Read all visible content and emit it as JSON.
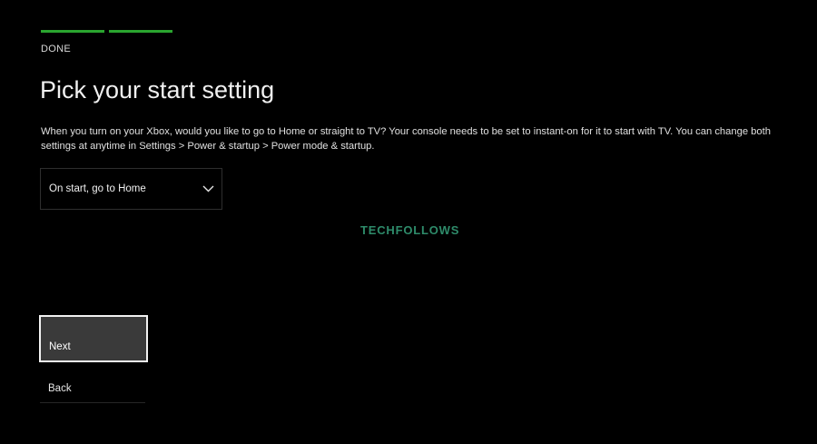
{
  "progress": {
    "step_label": "DONE",
    "segments_filled": 2,
    "accent_color": "#2aa52f"
  },
  "header": {
    "title": "Pick your start setting"
  },
  "main": {
    "description": "When you turn on your Xbox, would you like to go to Home or straight to TV? Your console needs to be set to instant-on for it to start with TV. You can change both settings at anytime in Settings > Power & startup > Power mode & startup.",
    "start_dropdown": {
      "selected": "On start, go to Home",
      "icon": "chevron-down-icon"
    }
  },
  "watermark": {
    "text": "TECHFOLLOWS"
  },
  "actions": {
    "next_label": "Next",
    "back_label": "Back"
  }
}
